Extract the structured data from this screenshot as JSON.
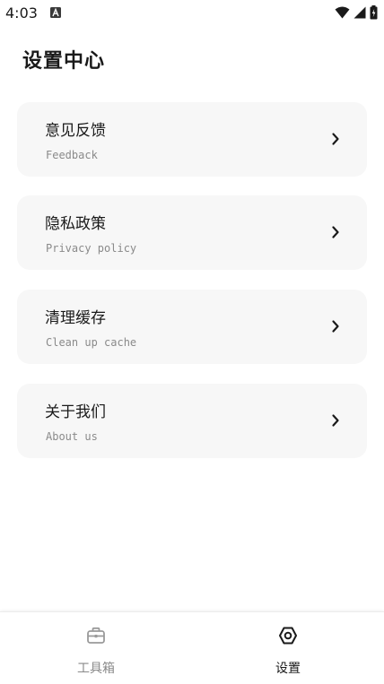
{
  "status_bar": {
    "time": "4:03"
  },
  "header": {
    "title": "设置中心"
  },
  "menu": [
    {
      "title": "意见反馈",
      "subtitle": "Feedback"
    },
    {
      "title": "隐私政策",
      "subtitle": "Privacy policy"
    },
    {
      "title": "清理缓存",
      "subtitle": "Clean up cache"
    },
    {
      "title": "关于我们",
      "subtitle": "About us"
    }
  ],
  "bottom_nav": {
    "items": [
      {
        "label": "工具箱",
        "icon": "toolbox-icon",
        "active": false
      },
      {
        "label": "设置",
        "icon": "settings-icon",
        "active": true
      }
    ]
  },
  "colors": {
    "card_bg": "#f7f7f7",
    "active_text": "#1a1a1a",
    "inactive_text": "#8a8a8a"
  }
}
